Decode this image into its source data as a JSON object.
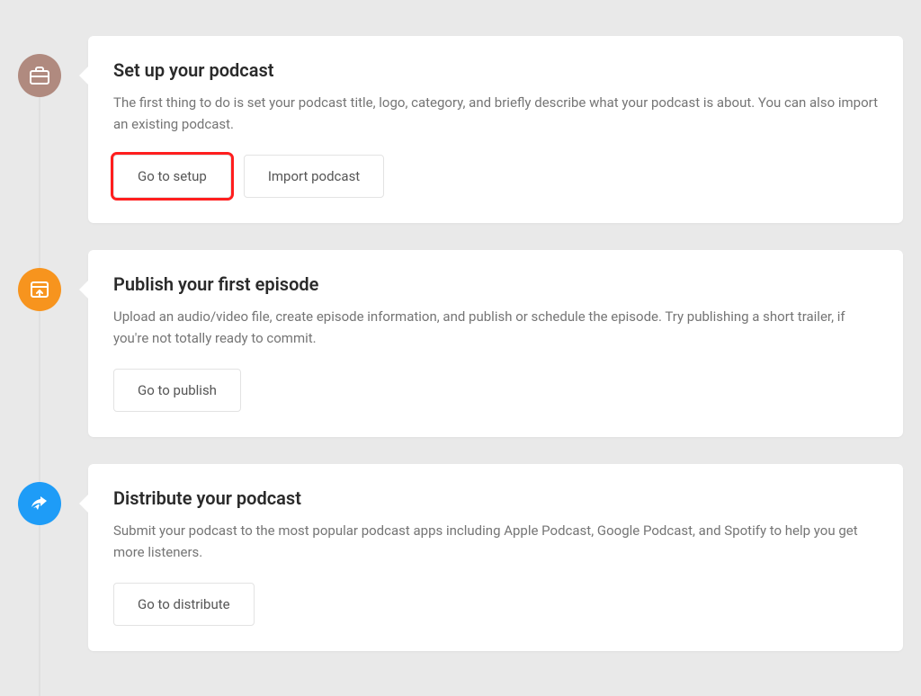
{
  "steps": [
    {
      "title": "Set up your podcast",
      "description": "The first thing to do is set your podcast title, logo, category, and briefly describe what your podcast is about. You can also import an existing podcast.",
      "buttons": [
        "Go to setup",
        "Import podcast"
      ],
      "icon": "briefcase-icon",
      "icon_color": "#b08a7f",
      "highlight_button_index": 0
    },
    {
      "title": "Publish your first episode",
      "description": "Upload an audio/video file, create episode information, and publish or schedule the episode. Try publishing a short trailer, if you're not totally ready to commit.",
      "buttons": [
        "Go to publish"
      ],
      "icon": "upload-icon",
      "icon_color": "#f7941e"
    },
    {
      "title": "Distribute your podcast",
      "description": "Submit your podcast to the most popular podcast apps including Apple Podcast, Google Podcast, and Spotify to help you get more listeners.",
      "buttons": [
        "Go to distribute"
      ],
      "icon": "share-icon",
      "icon_color": "#1e9cf7"
    }
  ]
}
